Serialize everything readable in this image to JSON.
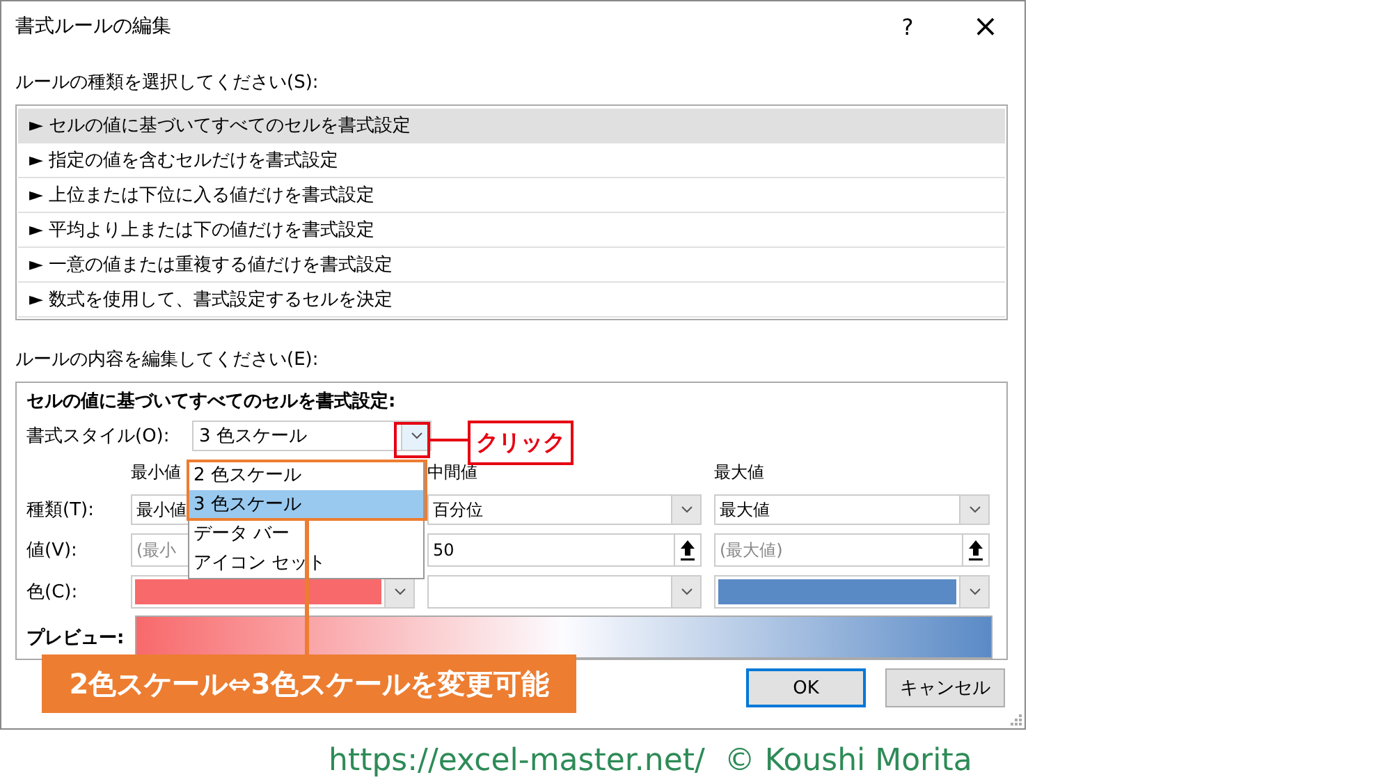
{
  "dialog": {
    "title": "書式ルールの編集",
    "help": "?",
    "close": "×"
  },
  "rule_type": {
    "label": "ルールの種類を選択してください(S):",
    "items": [
      {
        "text": "► セルの値に基づいてすべてのセルを書式設定",
        "selected": true
      },
      {
        "text": "► 指定の値を含むセルだけを書式設定",
        "selected": false
      },
      {
        "text": "► 上位または下位に入る値だけを書式設定",
        "selected": false
      },
      {
        "text": "► 平均より上または下の値だけを書式設定",
        "selected": false
      },
      {
        "text": "► 一意の値または重複する値だけを書式設定",
        "selected": false
      },
      {
        "text": "► 数式を使用して、書式設定するセルを決定",
        "selected": false
      }
    ]
  },
  "rule_edit": {
    "label": "ルールの内容を編集してください(E):",
    "heading": "セルの値に基づいてすべてのセルを書式設定:",
    "style_label": "書式スタイル(O):",
    "style_value": "3 色スケール",
    "style_options": [
      {
        "text": "2 色スケール",
        "selected": false
      },
      {
        "text": "3 色スケール",
        "selected": true
      },
      {
        "text": "データ バー",
        "selected": false
      },
      {
        "text": "アイコン セット",
        "selected": false
      }
    ],
    "row_labels": {
      "type": "種類(T):",
      "value": "値(V):",
      "swatch_row": "色(C):",
      "preview": "プレビュー:"
    },
    "columns": [
      {
        "header": "最小値",
        "type": "最小値",
        "placeholder": "(最小",
        "color": "#f8696b"
      },
      {
        "header": "中間値",
        "type": "百分位",
        "value": "50"
      },
      {
        "header": "最大値",
        "type": "最大値",
        "placeholder": "(最大値)",
        "color": "#5a8ac6"
      }
    ]
  },
  "buttons": [
    {
      "label": "OK",
      "kind": "default"
    },
    {
      "label": "キャンセル",
      "kind": "normal"
    }
  ],
  "annotations": {
    "click": "クリック",
    "note": "2色スケール⇔3色スケールを変更可能"
  },
  "footer": "https://excel-master.net/  © Koushi Morita"
}
